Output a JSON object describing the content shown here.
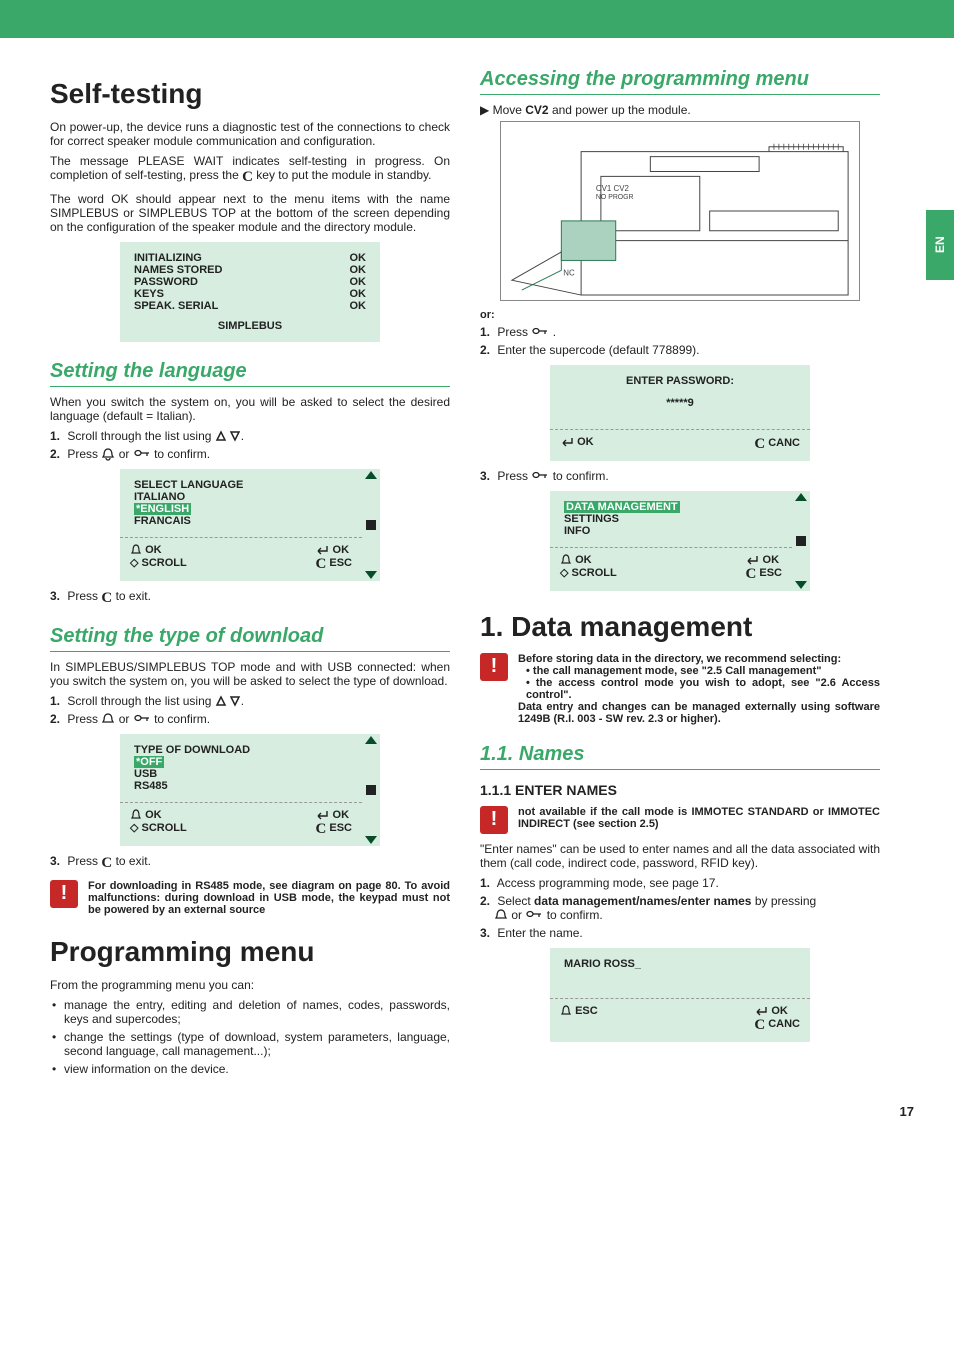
{
  "sidetab": "EN",
  "page_number": "17",
  "left": {
    "h1_self": "Self-testing",
    "p_self1": "On power-up, the device runs a diagnostic test of the connections to check for correct speaker module communication and configuration.",
    "p_self2_a": "The message PLEASE WAIT indicates self-testing in progress. On completion of self-testing, press the ",
    "p_self2_b": " key to put the module in standby.",
    "p_self3": "The word OK should appear next to the menu items with the name SIMPLEBUS or SIMPLEBUS TOP at the bottom of the screen depending on the configuration of the speaker module and the directory module.",
    "screen_self": {
      "rows": [
        {
          "l": "INITIALIZING",
          "r": "OK"
        },
        {
          "l": "NAMES STORED",
          "r": "OK"
        },
        {
          "l": "PASSWORD",
          "r": "OK"
        },
        {
          "l": "KEYS",
          "r": "OK"
        },
        {
          "l": "SPEAK. SERIAL",
          "r": "OK"
        }
      ],
      "footer": "SIMPLEBUS"
    },
    "h2_lang": "Setting the language",
    "p_lang": "When you switch the system on, you will be asked to select the desired language (default = Italian).",
    "lang_step1a": "Scroll through the list using ",
    "lang_step2a": "Press ",
    "lang_step2b": " or ",
    "lang_step2c": " to confirm.",
    "screen_lang": {
      "title": "SELECT LANGUAGE",
      "items": [
        "ITALIANO",
        "*ENGLISH",
        "FRANCAIS"
      ],
      "hl_index": 1,
      "left1": "OK",
      "left2": "SCROLL",
      "right1": "OK",
      "right2": "ESC"
    },
    "lang_step3a": "Press ",
    "lang_step3b": " to exit.",
    "h2_dl": "Setting the type of download",
    "p_dl": "In SIMPLEBUS/SIMPLEBUS TOP mode and with USB connected: when you switch the system on, you will be asked to select the type of download.",
    "dl_step1a": "Scroll through the list using ",
    "dl_step2a": "Press ",
    "dl_step2b": " or ",
    "dl_step2c": " to confirm.",
    "screen_dl": {
      "title": "TYPE OF DOWNLOAD",
      "items": [
        "*OFF",
        "USB",
        "RS485"
      ],
      "hl_index": 0,
      "left1": "OK",
      "left2": "SCROLL",
      "right1": "OK",
      "right2": "ESC"
    },
    "dl_step3a": "Press ",
    "dl_step3b": " to exit.",
    "warn_dl": "For downloading in RS485 mode, see diagram on page 80. To avoid malfunctions: during download in USB mode, the keypad must not be powered by an external source",
    "h1_prog": "Programming menu",
    "p_prog_intro": "From the programming menu you can:",
    "prog_items": [
      "manage the entry, editing and deletion of names, codes, passwords, keys and supercodes;",
      "change the settings (type of download, system parameters, language, second language, call management...);",
      "view information on the device."
    ]
  },
  "right": {
    "h2_access": "Accessing the programming menu",
    "access_step_a": "Move ",
    "access_cv2": "CV2",
    "access_step_b": " and power up the module.",
    "or": "or:",
    "access_s1a": "Press ",
    "access_s1b": ".",
    "access_s2": "Enter the supercode (default 778899).",
    "screen_pw": {
      "title": "ENTER PASSWORD:",
      "value": "*****9",
      "left": "OK",
      "right": "CANC"
    },
    "access_s3a": "Press ",
    "access_s3b": " to confirm.",
    "screen_menu": {
      "items": [
        "DATA MANAGEMENT",
        "SETTINGS",
        "INFO"
      ],
      "hl_index": 0,
      "left1": "OK",
      "left2": "SCROLL",
      "right1": "OK",
      "right2": "ESC"
    },
    "h1_data": "1. Data management",
    "warn_data_a": "Before storing data in the directory, we recommend selecting:",
    "warn_data_b1": "the call management mode, see \"2.5 Call management\"",
    "warn_data_b2": "the access control mode you wish to adopt, see \"2.6 Access control\".",
    "warn_data_c": "Data entry and changes can be managed externally using software 1249B (R.I. 003 - SW rev. 2.3 or higher).",
    "h2_names": "1.1. Names",
    "h3_enter": "1.1.1 ENTER NAMES",
    "warn_names": "not available if the call mode is IMMOTEC STANDARD or IMMOTEC INDIRECT (see section 2.5)",
    "p_enter": "\"Enter names\" can be used to enter names and all the data associated with them (call code, indirect code, password, RFID key).",
    "en_s1": "Access programming mode, see page 17.",
    "en_s2a": "Select ",
    "en_s2b": "data management/names/enter names",
    "en_s2c": " by pressing ",
    "en_s2d": " or ",
    "en_s2e": " to confirm.",
    "en_s3": "Enter the name.",
    "screen_name": {
      "value": "MARIO ROSS_",
      "left": "ESC",
      "right1": "OK",
      "right2": "CANC"
    }
  }
}
